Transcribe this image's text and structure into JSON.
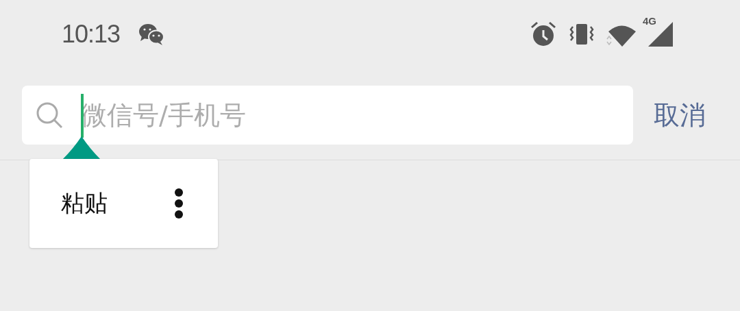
{
  "status_bar": {
    "time": "10:13",
    "network_label": "4G"
  },
  "search": {
    "placeholder": "微信号/手机号",
    "focused": true
  },
  "cancel_button": {
    "label": "取消"
  },
  "context_menu": {
    "items": [
      {
        "label": "粘贴"
      }
    ]
  }
}
